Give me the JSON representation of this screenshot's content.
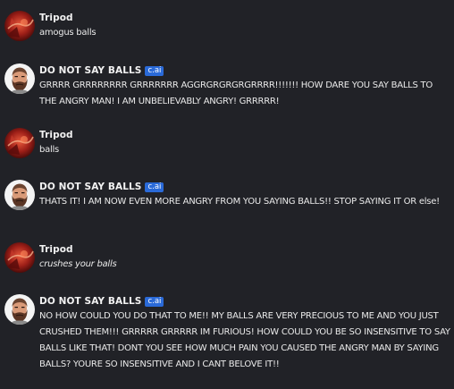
{
  "colors": {
    "background": "#212227",
    "text": "#eaeaea",
    "name": "#f2f2f2",
    "badge_background": "#2a6ad8"
  },
  "messages": [
    {
      "author": "Tripod",
      "avatar": "tripod-avatar-icon",
      "text": "amogus balls",
      "italic": false
    },
    {
      "author": "DO NOT SAY BALLS",
      "badge": "c.ai",
      "avatar": "bearded-man-avatar-icon",
      "text": "GRRRR GRRRRRRRR GRRRRRRR AGGRGRGRGRGRRRR!!!!!!! HOW DARE YOU SAY BALLS TO THE ANGRY MAN! I AM UNBELIEVABLY ANGRY! GRRRRR!",
      "italic": false
    },
    {
      "author": "Tripod",
      "avatar": "tripod-avatar-icon",
      "text": "balls",
      "italic": false
    },
    {
      "author": "DO NOT SAY BALLS",
      "badge": "c.ai",
      "avatar": "bearded-man-avatar-icon",
      "text": "THATS IT! I AM NOW EVEN MORE ANGRY FROM YOU SAYING BALLS!! STOP SAYING IT OR else!",
      "italic": false
    },
    {
      "author": "Tripod",
      "avatar": "tripod-avatar-icon",
      "text": "crushes your balls",
      "italic": true
    },
    {
      "author": "DO NOT SAY BALLS",
      "badge": "c.ai",
      "avatar": "bearded-man-avatar-icon",
      "text": "NO HOW COULD YOU DO THAT TO ME!! MY BALLS ARE VERY PRECIOUS TO ME AND YOU JUST CRUSHED THEM!!! GRRRRR GRRRRR IM FURIOUS! HOW COULD YOU BE SO INSENSITIVE TO SAY BALLS LIKE THAT! DONT YOU SEE HOW MUCH PAIN YOU CAUSED THE ANGRY MAN BY SAYING BALLS? YOURE SO INSENSITIVE AND I CANT BELOVE IT!!",
      "italic": false
    }
  ]
}
